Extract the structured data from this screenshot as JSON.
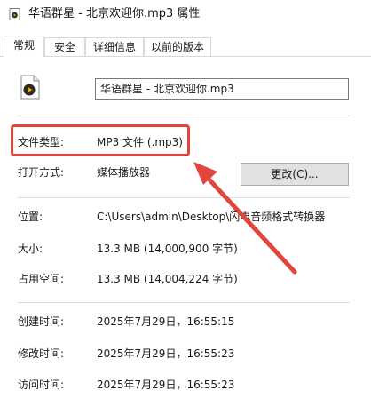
{
  "window": {
    "title": "华语群星 - 北京欢迎你.mp3 属性",
    "title_icon": "mp3-file-icon"
  },
  "tabs": [
    {
      "label": "常规",
      "active": true
    },
    {
      "label": "安全",
      "active": false
    },
    {
      "label": "详细信息",
      "active": false
    },
    {
      "label": "以前的版本",
      "active": false
    }
  ],
  "general": {
    "file_name": "华语群星 - 北京欢迎你.mp3",
    "file_type_label": "文件类型:",
    "file_type_value": "MP3 文件 (.mp3)",
    "open_with_label": "打开方式:",
    "open_with_value": "媒体播放器",
    "change_button": "更改(C)...",
    "location_label": "位置:",
    "location_value": "C:\\Users\\admin\\Desktop\\闪电音频格式转换器",
    "size_label": "大小:",
    "size_value": "13.3 MB (14,000,900 字节)",
    "size_on_disk_label": "占用空间:",
    "size_on_disk_value": "13.3 MB (14,004,224 字节)",
    "created_label": "创建时间:",
    "created_value": "2025年7月29日，16:55:15",
    "modified_label": "修改时间:",
    "modified_value": "2025年7月29日，16:55:23",
    "accessed_label": "访问时间:",
    "accessed_value": "2025年7月29日，16:55:23"
  },
  "annotation": {
    "highlight_color": "#e0463c"
  }
}
